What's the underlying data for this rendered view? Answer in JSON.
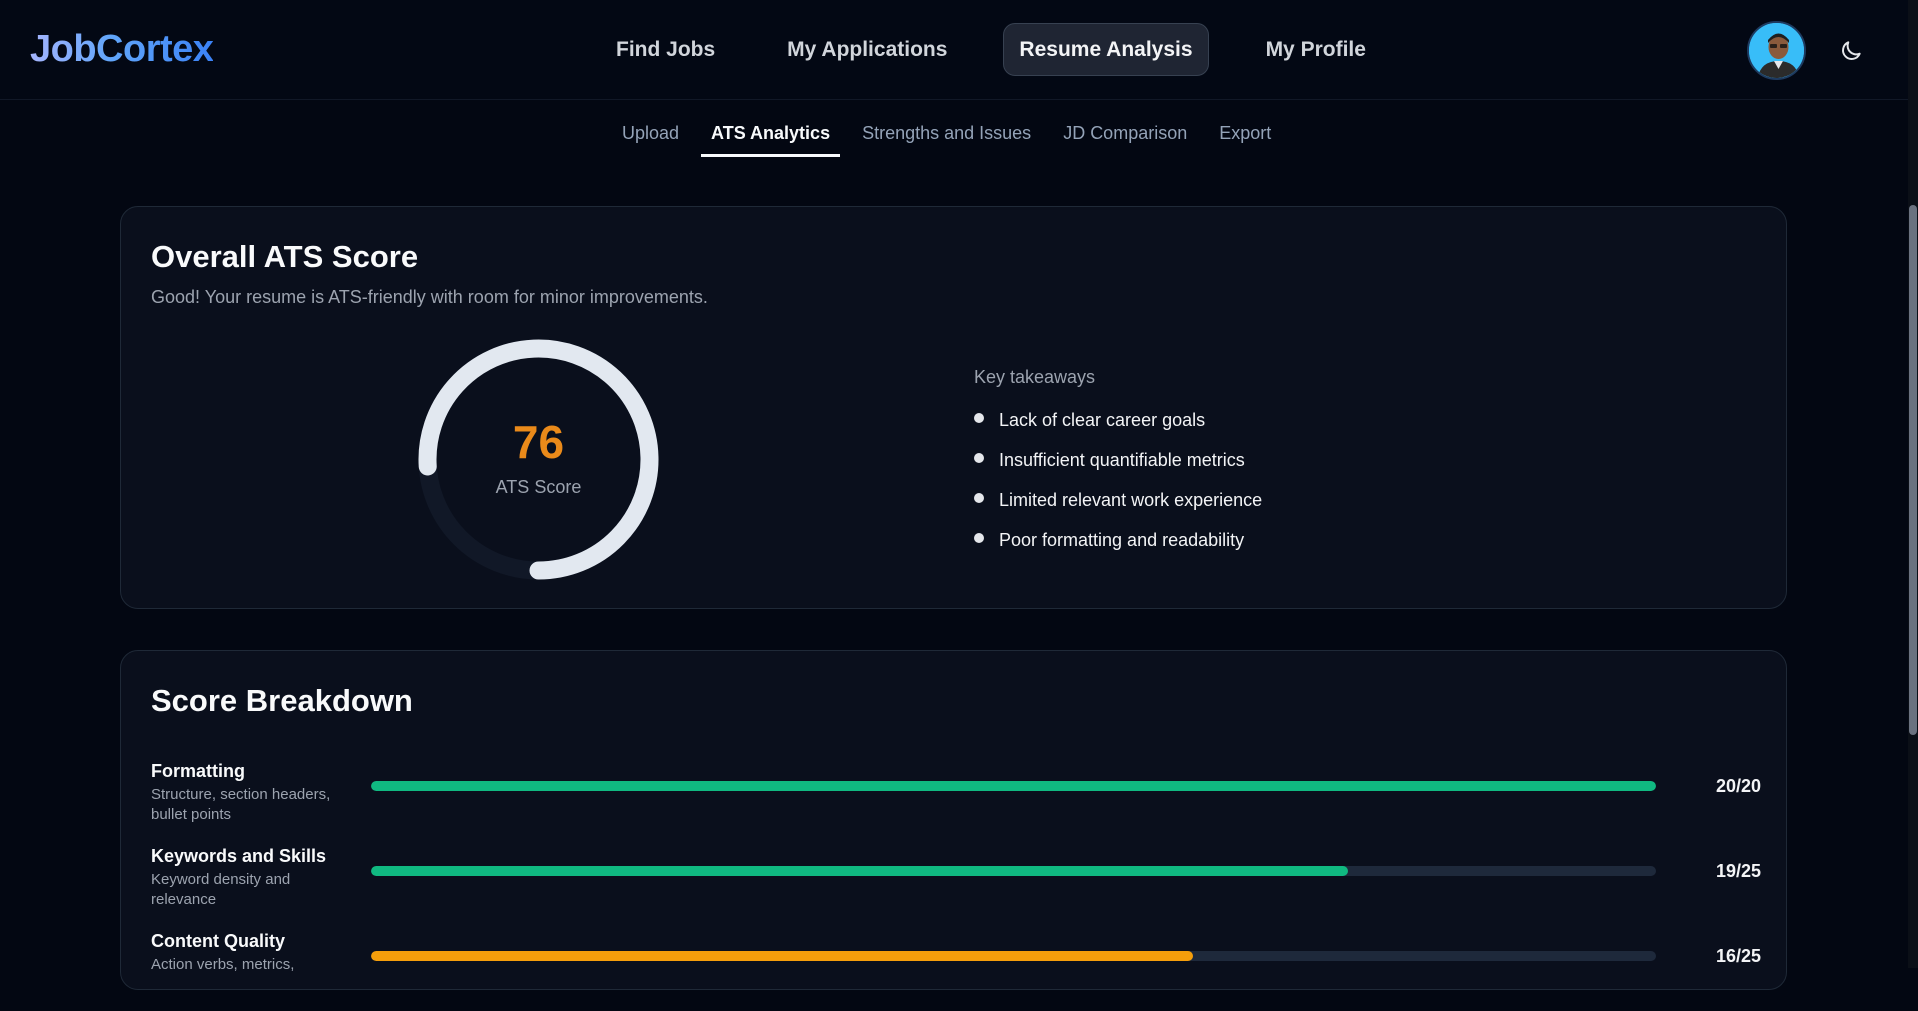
{
  "app": {
    "logo": "JobCortex"
  },
  "nav": {
    "items": [
      {
        "label": "Find Jobs"
      },
      {
        "label": "My Applications"
      },
      {
        "label": "Resume Analysis"
      },
      {
        "label": "My Profile"
      }
    ],
    "active": "Resume Analysis"
  },
  "subtabs": {
    "items": [
      {
        "label": "Upload"
      },
      {
        "label": "ATS Analytics"
      },
      {
        "label": "Strengths and Issues"
      },
      {
        "label": "JD Comparison"
      },
      {
        "label": "Export"
      }
    ],
    "active": "ATS Analytics"
  },
  "ats": {
    "title": "Overall ATS Score",
    "subtitle": "Good! Your resume is ATS-friendly with room for minor improvements.",
    "score": "76",
    "score_fraction": 0.76,
    "score_label": "ATS Score",
    "takeaways_title": "Key takeaways",
    "takeaways": [
      "Lack of clear career goals",
      "Insufficient quantifiable metrics",
      "Limited relevant work experience",
      "Poor formatting and readability"
    ]
  },
  "breakdown": {
    "title": "Score Breakdown",
    "rows": [
      {
        "name": "Formatting",
        "desc": "Structure, section headers, bullet points",
        "score": "20/20",
        "fraction": 1.0,
        "color": "#10b981"
      },
      {
        "name": "Keywords and Skills",
        "desc": "Keyword density and relevance",
        "score": "19/25",
        "fraction": 0.76,
        "color": "#10b981"
      },
      {
        "name": "Content Quality",
        "desc": "Action verbs, metrics,",
        "score": "16/25",
        "fraction": 0.64,
        "color": "#f59e0b"
      }
    ]
  },
  "colors": {
    "gauge_track": "#111827",
    "gauge_arc": "#e2e8f0",
    "score_accent": "#ea8a1a"
  },
  "icons": {
    "theme_toggle": "moon-icon",
    "avatar": "user-avatar"
  }
}
